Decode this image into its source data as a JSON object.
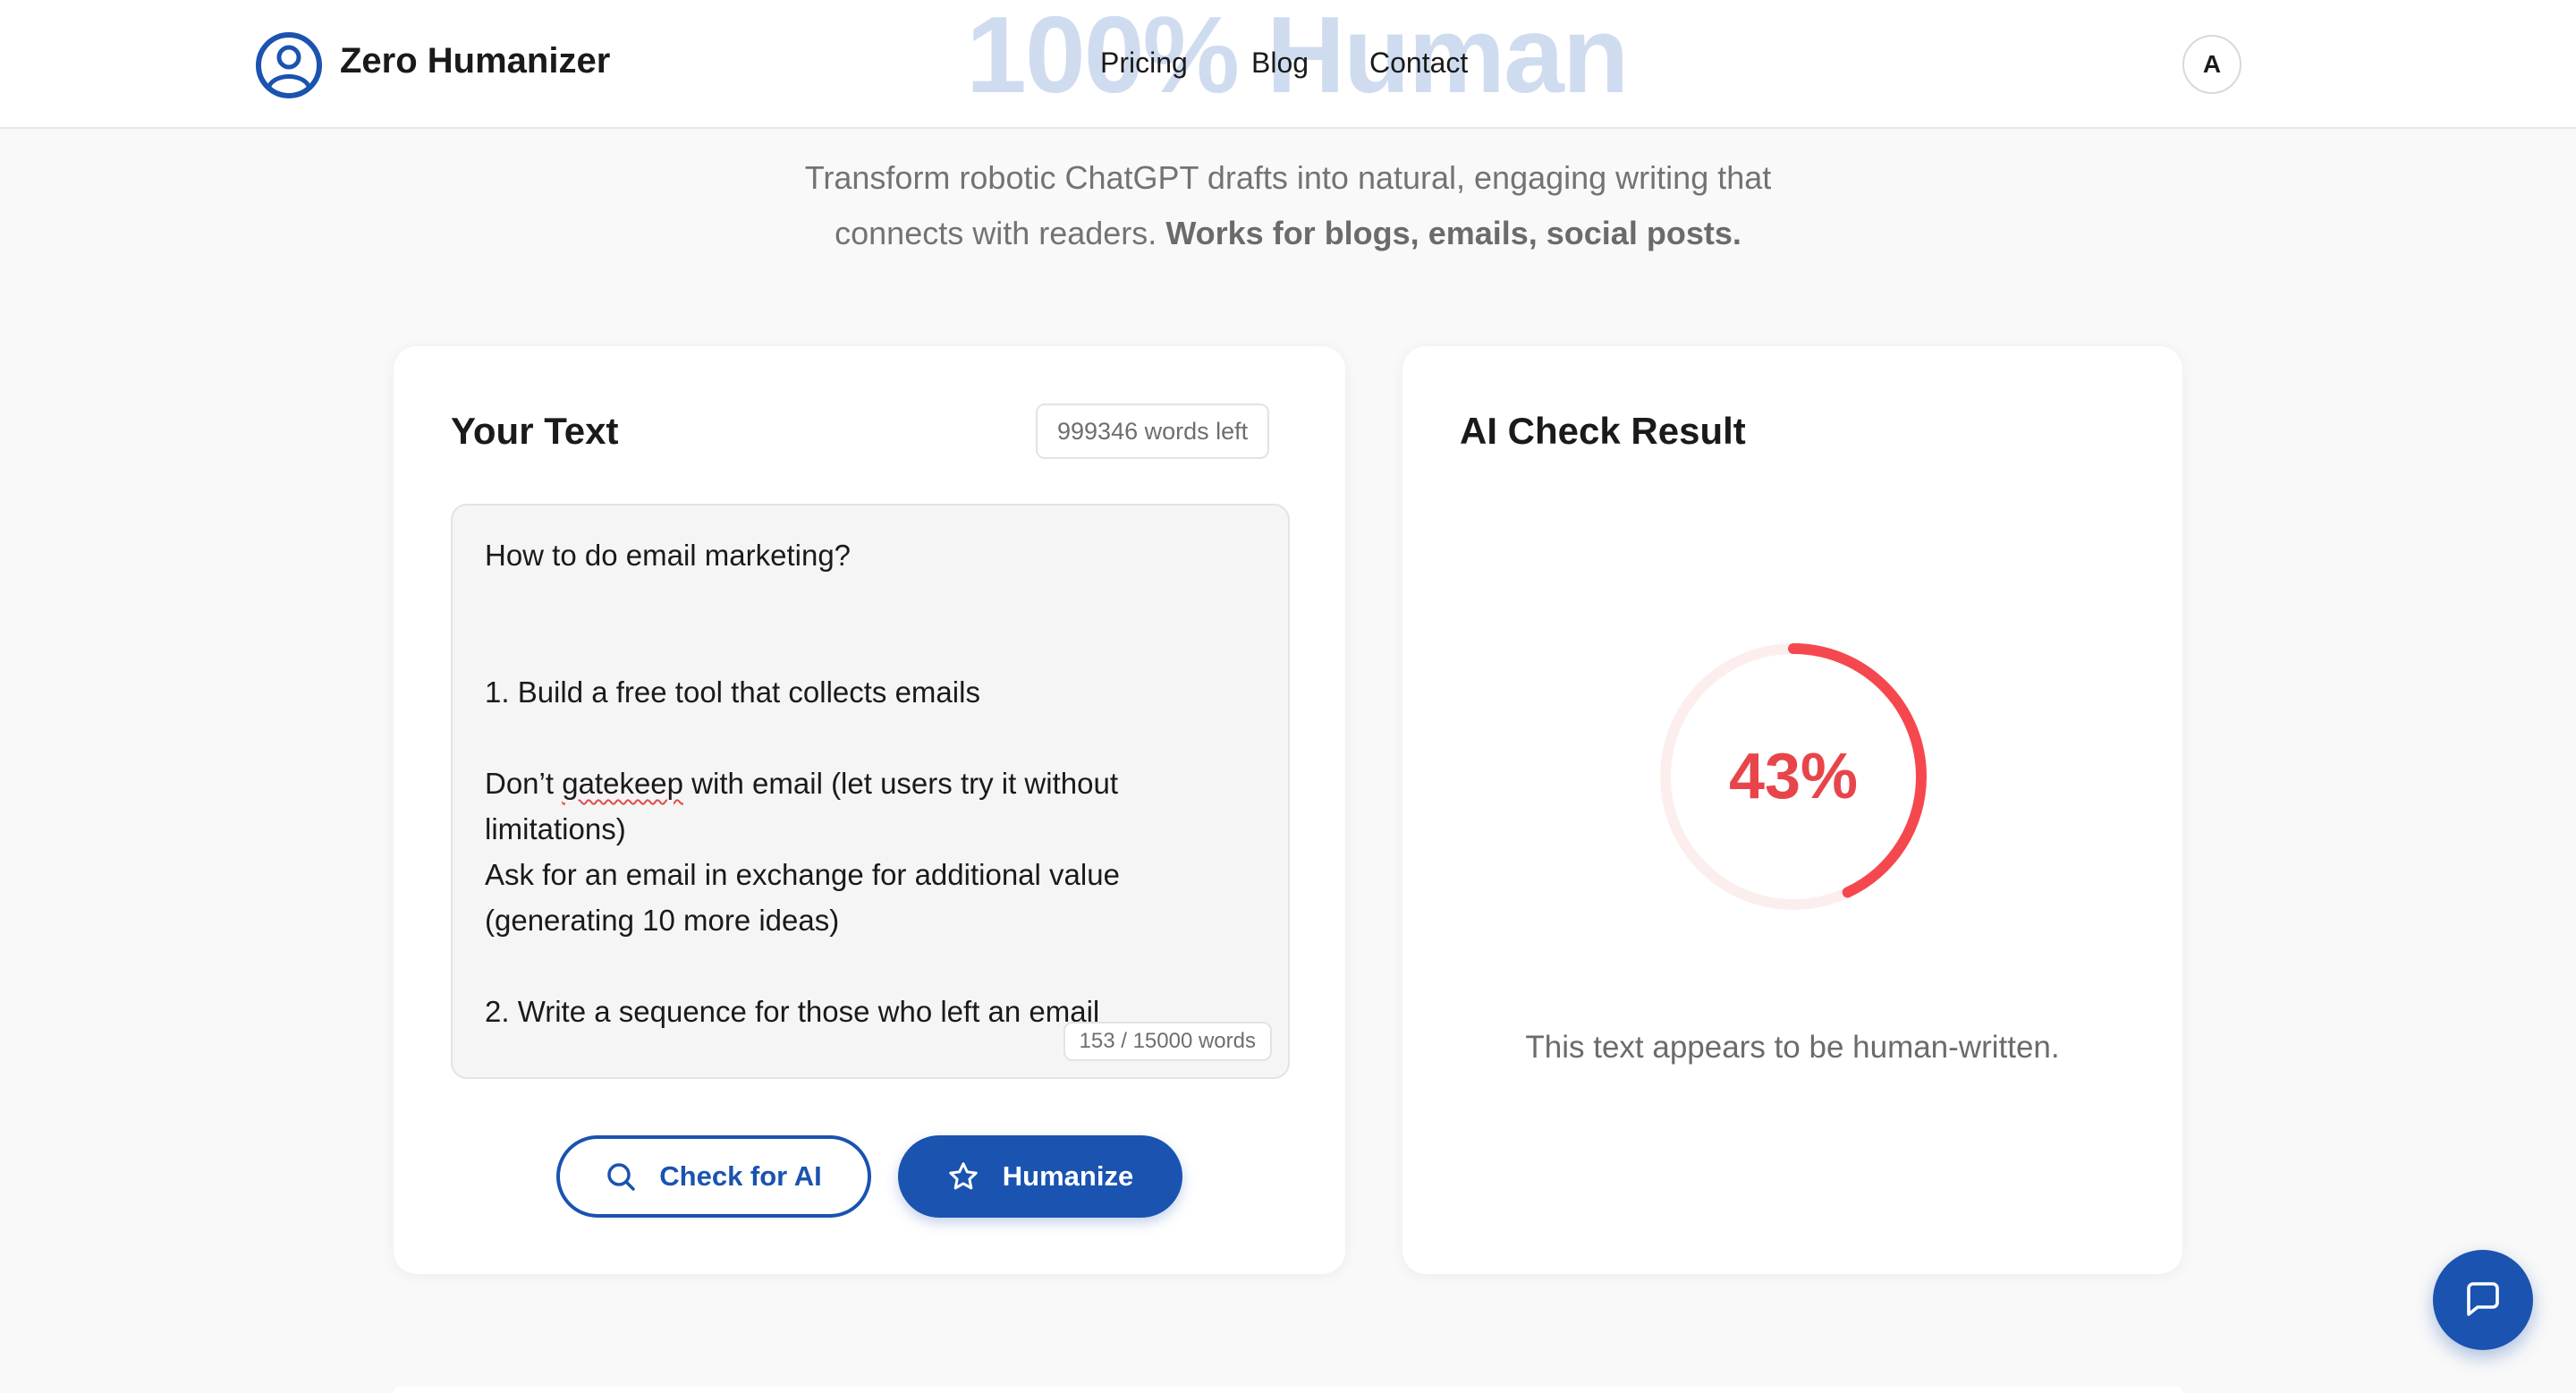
{
  "header": {
    "brand": "Zero Humanizer",
    "hero_title": "100% Human",
    "nav": {
      "pricing": "Pricing",
      "blog": "Blog",
      "contact": "Contact"
    },
    "avatar_initial": "A"
  },
  "subtitle": {
    "line1": "Transform robotic ChatGPT drafts into natural, engaging writing that",
    "line2_start": "connects with readers.",
    "line2_bold": "Works for blogs, emails, social posts."
  },
  "editor": {
    "title": "Your Text",
    "words_left": "999346 words left",
    "text": {
      "line1": "How to do email marketing?",
      "line2": "1. Build a free tool that collects emails",
      "line3_pre": "Don’t ",
      "line3_misspelled": "gatekeep",
      "line3_post": " with email (let users try it without limitations)",
      "line4": "Ask for an email in exchange for additional value (generating 10 more ideas)",
      "line5": "2. Write a sequence for those who left an email"
    },
    "word_count": "153 / 15000 words",
    "check_button": "Check for AI",
    "humanize_button": "Humanize"
  },
  "result": {
    "title": "AI Check Result",
    "percent_label": "43%",
    "percent_value": 43,
    "message": "This text appears to be human-written."
  },
  "colors": {
    "brand_blue": "#1a53b0",
    "gauge_red": "#f5484e",
    "gauge_track": "#fdeeee"
  },
  "icons": {
    "logo": "user-circle-icon",
    "check": "search-icon",
    "humanize": "star-icon",
    "chat": "chat-bubble-icon"
  }
}
